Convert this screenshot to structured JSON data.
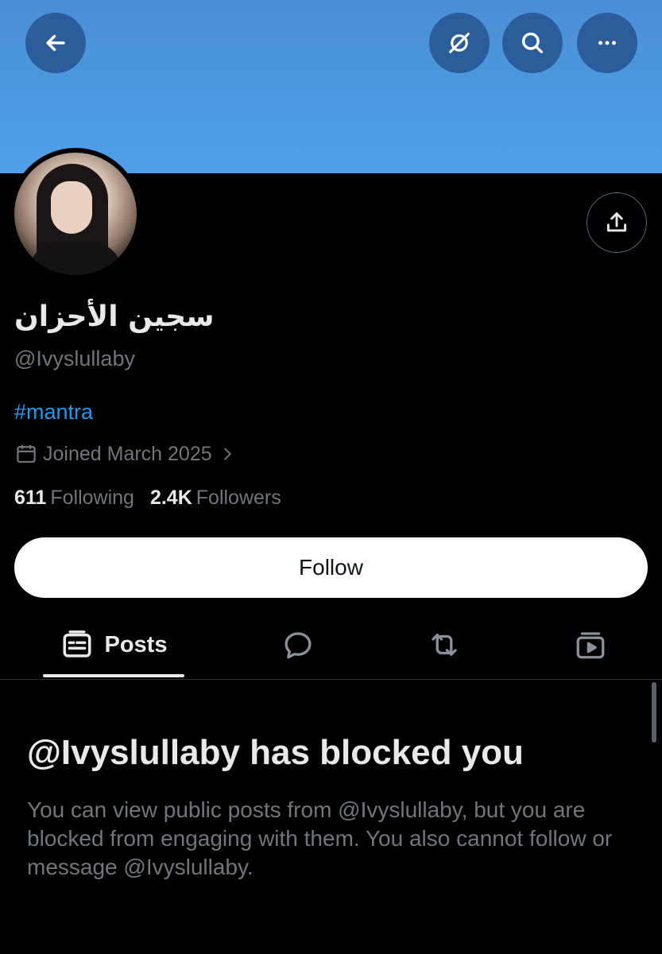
{
  "header": {
    "back_icon": "arrow-left-icon",
    "grok_icon": "grok-icon",
    "search_icon": "search-icon",
    "more_icon": "more-horizontal-icon",
    "banner_color": "#4b8fd6"
  },
  "profile": {
    "display_name": "سجين الأحزان",
    "handle": "@Ivyslullaby",
    "bio": "#mantra",
    "joined": "Joined March 2025",
    "following_count": "611",
    "following_label": "Following",
    "followers_count": "2.4K",
    "followers_label": "Followers",
    "share_icon": "share-icon"
  },
  "actions": {
    "follow_label": "Follow"
  },
  "tabs": [
    {
      "label": "Posts",
      "icon": "posts-icon",
      "selected": true
    },
    {
      "label": "",
      "icon": "replies-icon"
    },
    {
      "label": "",
      "icon": "reposts-icon"
    },
    {
      "label": "",
      "icon": "media-icon"
    }
  ],
  "blocked": {
    "title": "@Ivyslullaby has blocked you",
    "body": "You can view public posts from @Ivyslullaby, but you are blocked from engaging with them. You also cannot follow or message @Ivyslullaby."
  },
  "colors": {
    "accent": "#1d9bf0",
    "muted": "#71767b",
    "text": "#e7e9ea"
  }
}
